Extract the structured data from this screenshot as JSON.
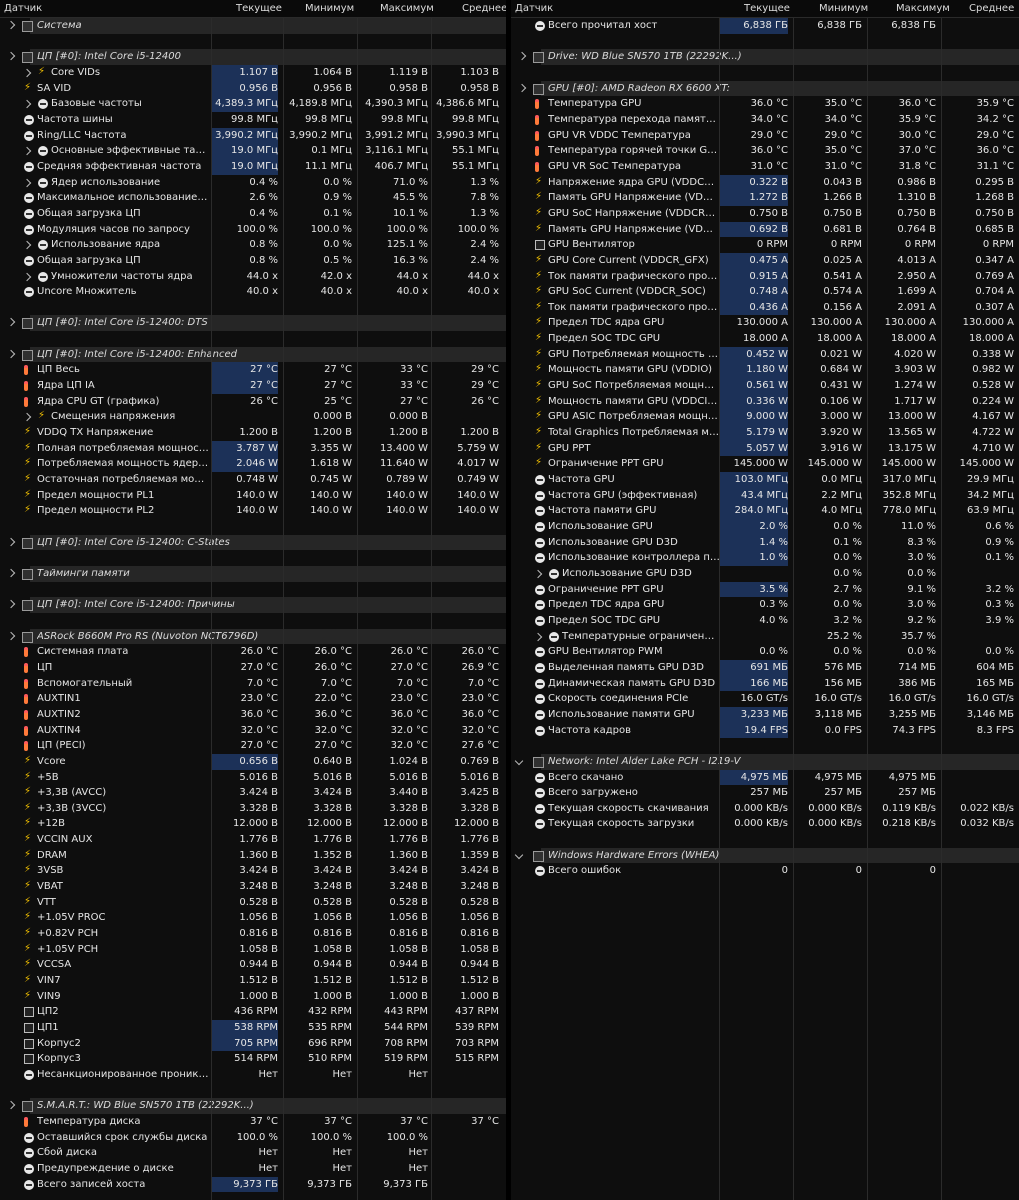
{
  "headers": {
    "sensor": "Датчик",
    "current": "Текущее",
    "min": "Минимум",
    "max": "Максимум",
    "avg": "Среднее"
  },
  "left": [
    {
      "t": "g",
      "name": "Система"
    },
    {
      "t": "s"
    },
    {
      "t": "g",
      "name": "ЦП [#0]: Intel Core i5-12400"
    },
    {
      "i": "bolt",
      "exp": 1,
      "ind": 1,
      "name": "Core VIDs",
      "c": "1.107 В",
      "mn": "1.064 В",
      "mx": "1.119 В",
      "av": "1.103 В",
      "h": 1
    },
    {
      "i": "bolt",
      "name": "SA VID",
      "c": "0.956 В",
      "mn": "0.956 В",
      "mx": "0.958 В",
      "av": "0.958 В",
      "h": 1
    },
    {
      "i": "clock",
      "exp": 1,
      "ind": 1,
      "name": "Базовые частоты",
      "c": "4,389.3 МГц",
      "mn": "4,189.8 МГц",
      "mx": "4,390.3 МГц",
      "av": "4,386.6 МГц",
      "h": 1
    },
    {
      "i": "clock",
      "name": "Частота шины",
      "c": "99.8 МГц",
      "mn": "99.8 МГц",
      "mx": "99.8 МГц",
      "av": "99.8 МГц"
    },
    {
      "i": "clock",
      "name": "Ring/LLC Частота",
      "c": "3,990.2 МГц",
      "mn": "3,990.2 МГц",
      "mx": "3,991.2 МГц",
      "av": "3,990.3 МГц",
      "h": 1
    },
    {
      "i": "clock",
      "exp": 1,
      "ind": 1,
      "name": "Основные эффективные тактовые частоты",
      "c": "19.0 МГц",
      "mn": "0.1 МГц",
      "mx": "3,116.1 МГц",
      "av": "55.1 МГц",
      "h": 1
    },
    {
      "i": "clock",
      "name": "Средняя эффективная частота",
      "c": "19.0 МГц",
      "mn": "11.1 МГц",
      "mx": "406.7 МГц",
      "av": "55.1 МГц",
      "h": 1
    },
    {
      "i": "clock",
      "exp": 1,
      "ind": 1,
      "name": "Ядер использование",
      "c": "0.4 %",
      "mn": "0.0 %",
      "mx": "71.0 %",
      "av": "1.3 %"
    },
    {
      "i": "clock",
      "name": "Максимальное использование ЦП / поток",
      "c": "2.6 %",
      "mn": "0.9 %",
      "mx": "45.5 %",
      "av": "7.8 %"
    },
    {
      "i": "clock",
      "name": "Общая загрузка ЦП",
      "c": "0.4 %",
      "mn": "0.1 %",
      "mx": "10.1 %",
      "av": "1.3 %"
    },
    {
      "i": "clock",
      "name": "Модуляция часов по запросу",
      "c": "100.0 %",
      "mn": "100.0 %",
      "mx": "100.0 %",
      "av": "100.0 %"
    },
    {
      "i": "clock",
      "exp": 1,
      "ind": 1,
      "name": "Использование ядра",
      "c": "0.8 %",
      "mn": "0.0 %",
      "mx": "125.1 %",
      "av": "2.4 %"
    },
    {
      "i": "clock",
      "name": "Общая загрузка ЦП",
      "c": "0.8 %",
      "mn": "0.5 %",
      "mx": "16.3 %",
      "av": "2.4 %"
    },
    {
      "i": "clock",
      "exp": 1,
      "ind": 1,
      "name": "Умножители частоты ядра",
      "c": "44.0 x",
      "mn": "42.0 x",
      "mx": "44.0 x",
      "av": "44.0 x"
    },
    {
      "i": "clock",
      "name": "Uncore Множитель",
      "c": "40.0 x",
      "mn": "40.0 x",
      "mx": "40.0 x",
      "av": "40.0 x"
    },
    {
      "t": "s"
    },
    {
      "t": "g",
      "name": "ЦП [#0]: Intel Core i5-12400: DTS"
    },
    {
      "t": "s"
    },
    {
      "t": "g",
      "name": "ЦП [#0]: Intel Core i5-12400: Enhanced"
    },
    {
      "i": "therm",
      "name": "ЦП Весь",
      "c": "27 °C",
      "mn": "27 °C",
      "mx": "33 °C",
      "av": "29 °C",
      "h": 1
    },
    {
      "i": "therm",
      "name": "Ядра ЦП IA",
      "c": "27 °C",
      "mn": "27 °C",
      "mx": "33 °C",
      "av": "29 °C",
      "h": 1
    },
    {
      "i": "therm",
      "name": "Ядра CPU GT (графика)",
      "c": "26 °C",
      "mn": "25 °C",
      "mx": "27 °C",
      "av": "26 °C"
    },
    {
      "i": "bolt",
      "exp": 1,
      "ind": 1,
      "name": "Смещения напряжения",
      "c": "",
      "mn": "0.000 В",
      "mx": "0.000 В",
      "av": ""
    },
    {
      "i": "bolt",
      "name": "VDDQ TX Напряжение",
      "c": "1.200 В",
      "mn": "1.200 В",
      "mx": "1.200 В",
      "av": "1.200 В"
    },
    {
      "i": "bolt",
      "name": "Полная потребляемая мощность ЦП",
      "c": "3.787 W",
      "mn": "3.355 W",
      "mx": "13.400 W",
      "av": "5.759 W",
      "h": 1
    },
    {
      "i": "bolt",
      "name": "Потребляемая мощность ядер IA",
      "c": "2.046 W",
      "mn": "1.618 W",
      "mx": "11.640 W",
      "av": "4.017 W",
      "h": 1
    },
    {
      "i": "bolt",
      "name": "Остаточная потребляемая мощность",
      "c": "0.748 W",
      "mn": "0.745 W",
      "mx": "0.789 W",
      "av": "0.749 W"
    },
    {
      "i": "bolt",
      "name": "Предел мощности PL1",
      "c": "140.0 W",
      "mn": "140.0 W",
      "mx": "140.0 W",
      "av": "140.0 W"
    },
    {
      "i": "bolt",
      "name": "Предел мощности PL2",
      "c": "140.0 W",
      "mn": "140.0 W",
      "mx": "140.0 W",
      "av": "140.0 W"
    },
    {
      "t": "s"
    },
    {
      "t": "g",
      "name": "ЦП [#0]: Intel Core i5-12400: C-States"
    },
    {
      "t": "s"
    },
    {
      "t": "g",
      "name": "Тайминги памяти"
    },
    {
      "t": "s"
    },
    {
      "t": "g",
      "name": "ЦП [#0]: Intel Core i5-12400: Причины"
    },
    {
      "t": "s"
    },
    {
      "t": "g",
      "name": "ASRock B660M Pro RS (Nuvoton NCT6796D)"
    },
    {
      "i": "therm",
      "name": "Системная плата",
      "c": "26.0 °C",
      "mn": "26.0 °C",
      "mx": "26.0 °C",
      "av": "26.0 °C"
    },
    {
      "i": "therm",
      "name": "ЦП",
      "c": "27.0 °C",
      "mn": "26.0 °C",
      "mx": "27.0 °C",
      "av": "26.9 °C"
    },
    {
      "i": "therm",
      "name": "Вспомогательный",
      "c": "7.0 °C",
      "mn": "7.0 °C",
      "mx": "7.0 °C",
      "av": "7.0 °C"
    },
    {
      "i": "therm",
      "name": "AUXTIN1",
      "c": "23.0 °C",
      "mn": "22.0 °C",
      "mx": "23.0 °C",
      "av": "23.0 °C"
    },
    {
      "i": "therm",
      "name": "AUXTIN2",
      "c": "36.0 °C",
      "mn": "36.0 °C",
      "mx": "36.0 °C",
      "av": "36.0 °C"
    },
    {
      "i": "therm",
      "name": "AUXTIN4",
      "c": "32.0 °C",
      "mn": "32.0 °C",
      "mx": "32.0 °C",
      "av": "32.0 °C"
    },
    {
      "i": "therm",
      "name": "ЦП (PECI)",
      "c": "27.0 °C",
      "mn": "27.0 °C",
      "mx": "32.0 °C",
      "av": "27.6 °C"
    },
    {
      "i": "bolt",
      "name": "Vcore",
      "c": "0.656 В",
      "mn": "0.640 В",
      "mx": "1.024 В",
      "av": "0.769 В",
      "h": 1
    },
    {
      "i": "bolt",
      "name": "+5В",
      "c": "5.016 В",
      "mn": "5.016 В",
      "mx": "5.016 В",
      "av": "5.016 В"
    },
    {
      "i": "bolt",
      "name": "+3,3В (AVCC)",
      "c": "3.424 В",
      "mn": "3.424 В",
      "mx": "3.440 В",
      "av": "3.425 В"
    },
    {
      "i": "bolt",
      "name": "+3,3В (3VCC)",
      "c": "3.328 В",
      "mn": "3.328 В",
      "mx": "3.328 В",
      "av": "3.328 В"
    },
    {
      "i": "bolt",
      "name": "+12В",
      "c": "12.000 В",
      "mn": "12.000 В",
      "mx": "12.000 В",
      "av": "12.000 В"
    },
    {
      "i": "bolt",
      "name": "VCCIN AUX",
      "c": "1.776 В",
      "mn": "1.776 В",
      "mx": "1.776 В",
      "av": "1.776 В"
    },
    {
      "i": "bolt",
      "name": "DRAM",
      "c": "1.360 В",
      "mn": "1.352 В",
      "mx": "1.360 В",
      "av": "1.359 В"
    },
    {
      "i": "bolt",
      "name": "3VSB",
      "c": "3.424 В",
      "mn": "3.424 В",
      "mx": "3.424 В",
      "av": "3.424 В"
    },
    {
      "i": "bolt",
      "name": "VBAT",
      "c": "3.248 В",
      "mn": "3.248 В",
      "mx": "3.248 В",
      "av": "3.248 В"
    },
    {
      "i": "bolt",
      "name": "VTT",
      "c": "0.528 В",
      "mn": "0.528 В",
      "mx": "0.528 В",
      "av": "0.528 В"
    },
    {
      "i": "bolt",
      "name": "+1.05V PROC",
      "c": "1.056 В",
      "mn": "1.056 В",
      "mx": "1.056 В",
      "av": "1.056 В"
    },
    {
      "i": "bolt",
      "name": "+0.82V PCH",
      "c": "0.816 В",
      "mn": "0.816 В",
      "mx": "0.816 В",
      "av": "0.816 В"
    },
    {
      "i": "bolt",
      "name": "+1.05V PCH",
      "c": "1.058 В",
      "mn": "1.058 В",
      "mx": "1.058 В",
      "av": "1.058 В"
    },
    {
      "i": "bolt",
      "name": "VCCSA",
      "c": "0.944 В",
      "mn": "0.944 В",
      "mx": "0.944 В",
      "av": "0.944 В"
    },
    {
      "i": "bolt",
      "name": "VIN7",
      "c": "1.512 В",
      "mn": "1.512 В",
      "mx": "1.512 В",
      "av": "1.512 В"
    },
    {
      "i": "bolt",
      "name": "VIN9",
      "c": "1.000 В",
      "mn": "1.000 В",
      "mx": "1.000 В",
      "av": "1.000 В"
    },
    {
      "i": "fan",
      "name": "ЦП2",
      "c": "436 RPM",
      "mn": "432 RPM",
      "mx": "443 RPM",
      "av": "437 RPM"
    },
    {
      "i": "fan",
      "name": "ЦП1",
      "c": "538 RPM",
      "mn": "535 RPM",
      "mx": "544 RPM",
      "av": "539 RPM",
      "h": 1
    },
    {
      "i": "fan",
      "name": "Корпус2",
      "c": "705 RPM",
      "mn": "696 RPM",
      "mx": "708 RPM",
      "av": "703 RPM",
      "h": 1
    },
    {
      "i": "fan",
      "name": "Корпус3",
      "c": "514 RPM",
      "mn": "510 RPM",
      "mx": "519 RPM",
      "av": "515 RPM"
    },
    {
      "i": "clock",
      "name": "Несанкционированное проникновение",
      "c": "Нет",
      "mn": "Нет",
      "mx": "Нет",
      "av": ""
    },
    {
      "t": "s"
    },
    {
      "t": "g",
      "name": "S.M.A.R.T.: WD Blue SN570 1TB (22292K...)"
    },
    {
      "i": "therm",
      "name": "Температура диска",
      "c": "37 °C",
      "mn": "37 °C",
      "mx": "37 °C",
      "av": "37 °C"
    },
    {
      "i": "clock",
      "name": "Оставшийся срок службы диска",
      "c": "100.0 %",
      "mn": "100.0 %",
      "mx": "100.0 %",
      "av": ""
    },
    {
      "i": "clock",
      "name": "Сбой диска",
      "c": "Нет",
      "mn": "Нет",
      "mx": "Нет",
      "av": ""
    },
    {
      "i": "clock",
      "name": "Предупреждение о диске",
      "c": "Нет",
      "mn": "Нет",
      "mx": "Нет",
      "av": ""
    },
    {
      "i": "clock",
      "name": "Всего записей хоста",
      "c": "9,373 ГБ",
      "mn": "9,373 ГБ",
      "mx": "9,373 ГБ",
      "av": "",
      "h": 1
    }
  ],
  "right": [
    {
      "i": "clock",
      "name": "Всего прочитал хост",
      "c": "6,838 ГБ",
      "mn": "6,838 ГБ",
      "mx": "6,838 ГБ",
      "av": "",
      "h": 1
    },
    {
      "t": "s"
    },
    {
      "t": "g",
      "name": "Drive: WD Blue SN570 1TB (22292K...)"
    },
    {
      "t": "s"
    },
    {
      "t": "g",
      "name": "GPU [#0]: AMD Radeon RX 6600 XT:"
    },
    {
      "i": "therm",
      "name": "Температура GPU",
      "c": "36.0 °C",
      "mn": "35.0 °C",
      "mx": "36.0 °C",
      "av": "35.9 °C"
    },
    {
      "i": "therm",
      "name": "Температура перехода памяти GPU",
      "c": "34.0 °C",
      "mn": "34.0 °C",
      "mx": "35.9 °C",
      "av": "34.2 °C"
    },
    {
      "i": "therm",
      "name": "GPU VR VDDC Температура",
      "c": "29.0 °C",
      "mn": "29.0 °C",
      "mx": "30.0 °C",
      "av": "29.0 °C"
    },
    {
      "i": "therm",
      "name": "Температура горячей точки GPU",
      "c": "36.0 °C",
      "mn": "35.0 °C",
      "mx": "37.0 °C",
      "av": "36.0 °C"
    },
    {
      "i": "therm",
      "name": "GPU VR SoC Температура",
      "c": "31.0 °C",
      "mn": "31.0 °C",
      "mx": "31.8 °C",
      "av": "31.1 °C"
    },
    {
      "i": "bolt",
      "name": "Напряжение ядра GPU (VDDCR_GFX)",
      "c": "0.322 В",
      "mn": "0.043 В",
      "mx": "0.986 В",
      "av": "0.295 В",
      "h": 1
    },
    {
      "i": "bolt",
      "name": "Память GPU Напряжение (VDDIO)",
      "c": "1.272 В",
      "mn": "1.266 В",
      "mx": "1.310 В",
      "av": "1.268 В",
      "h": 1
    },
    {
      "i": "bolt",
      "name": "GPU SoC Напряжение (VDDCR_SOC)",
      "c": "0.750 В",
      "mn": "0.750 В",
      "mx": "0.750 В",
      "av": "0.750 В"
    },
    {
      "i": "bolt",
      "name": "Память GPU Напряжение (VDDCI_MEM)",
      "c": "0.692 В",
      "mn": "0.681 В",
      "mx": "0.764 В",
      "av": "0.685 В",
      "h": 1
    },
    {
      "i": "fan",
      "name": "GPU Вентилятор",
      "c": "0 RPM",
      "mn": "0 RPM",
      "mx": "0 RPM",
      "av": "0 RPM"
    },
    {
      "i": "bolt",
      "name": "GPU Core Current (VDDCR_GFX)",
      "c": "0.475 A",
      "mn": "0.025 A",
      "mx": "4.013 A",
      "av": "0.347 A",
      "h": 1
    },
    {
      "i": "bolt",
      "name": "Ток памяти графического процессора",
      "c": "0.915 A",
      "mn": "0.541 A",
      "mx": "2.950 A",
      "av": "0.769 A",
      "h": 1
    },
    {
      "i": "bolt",
      "name": "GPU SoC Current (VDDCR_SOC)",
      "c": "0.748 A",
      "mn": "0.574 A",
      "mx": "1.699 A",
      "av": "0.704 A",
      "h": 1
    },
    {
      "i": "bolt",
      "name": "Ток памяти графического процессора",
      "c": "0.436 A",
      "mn": "0.156 A",
      "mx": "2.091 A",
      "av": "0.307 A",
      "h": 1
    },
    {
      "i": "bolt",
      "name": "Предел TDC ядра GPU",
      "c": "130.000 A",
      "mn": "130.000 A",
      "mx": "130.000 A",
      "av": "130.000 A"
    },
    {
      "i": "bolt",
      "name": "Предел SOC TDC GPU",
      "c": "18.000 A",
      "mn": "18.000 A",
      "mx": "18.000 A",
      "av": "18.000 A"
    },
    {
      "i": "bolt",
      "name": "GPU Потребляемая мощность ядра",
      "c": "0.452 W",
      "mn": "0.021 W",
      "mx": "4.020 W",
      "av": "0.338 W",
      "h": 1
    },
    {
      "i": "bolt",
      "name": "Мощность памяти GPU (VDDIO)",
      "c": "1.180 W",
      "mn": "0.684 W",
      "mx": "3.903 W",
      "av": "0.982 W",
      "h": 1
    },
    {
      "i": "bolt",
      "name": "GPU SoC Потребляемая мощность",
      "c": "0.561 W",
      "mn": "0.431 W",
      "mx": "1.274 W",
      "av": "0.528 W",
      "h": 1
    },
    {
      "i": "bolt",
      "name": "Мощность памяти GPU (VDDCI_MEM)",
      "c": "0.336 W",
      "mn": "0.106 W",
      "mx": "1.717 W",
      "av": "0.224 W",
      "h": 1
    },
    {
      "i": "bolt",
      "name": "GPU ASIC Потребляемая мощность",
      "c": "9.000 W",
      "mn": "3.000 W",
      "mx": "13.000 W",
      "av": "4.167 W",
      "h": 1
    },
    {
      "i": "bolt",
      "name": "Total Graphics Потребляемая мощность",
      "c": "5.179 W",
      "mn": "3.920 W",
      "mx": "13.565 W",
      "av": "4.722 W",
      "h": 1
    },
    {
      "i": "bolt",
      "name": "GPU PPT",
      "c": "5.057 W",
      "mn": "3.916 W",
      "mx": "13.175 W",
      "av": "4.710 W",
      "h": 1
    },
    {
      "i": "bolt",
      "name": "Ограничение PPT GPU",
      "c": "145.000 W",
      "mn": "145.000 W",
      "mx": "145.000 W",
      "av": "145.000 W"
    },
    {
      "i": "clock",
      "name": "Частота GPU",
      "c": "103.0 МГц",
      "mn": "0.0 МГц",
      "mx": "317.0 МГц",
      "av": "29.9 МГц",
      "h": 1
    },
    {
      "i": "clock",
      "name": "Частота GPU (эффективная)",
      "c": "43.4 МГц",
      "mn": "2.2 МГц",
      "mx": "352.8 МГц",
      "av": "34.2 МГц",
      "h": 1
    },
    {
      "i": "clock",
      "name": "Частота памяти GPU",
      "c": "284.0 МГц",
      "mn": "4.0 МГц",
      "mx": "778.0 МГц",
      "av": "63.9 МГц",
      "h": 1
    },
    {
      "i": "clock",
      "name": "Использование GPU",
      "c": "2.0 %",
      "mn": "0.0 %",
      "mx": "11.0 %",
      "av": "0.6 %",
      "h": 1
    },
    {
      "i": "clock",
      "name": "Использование GPU D3D",
      "c": "1.4 %",
      "mn": "0.1 %",
      "mx": "8.3 %",
      "av": "0.9 %",
      "h": 1
    },
    {
      "i": "clock",
      "name": "Использование контроллера памяти GPU",
      "c": "1.0 %",
      "mn": "0.0 %",
      "mx": "3.0 %",
      "av": "0.1 %",
      "h": 1
    },
    {
      "i": "clock",
      "exp": 1,
      "ind": 1,
      "name": "Использование GPU D3D",
      "c": "",
      "mn": "0.0 %",
      "mx": "0.0 %",
      "av": ""
    },
    {
      "i": "clock",
      "name": "Ограничение PPT GPU",
      "c": "3.5 %",
      "mn": "2.7 %",
      "mx": "9.1 %",
      "av": "3.2 %",
      "h": 1
    },
    {
      "i": "clock",
      "name": "Предел TDC ядра GPU",
      "c": "0.3 %",
      "mn": "0.0 %",
      "mx": "3.0 %",
      "av": "0.3 %"
    },
    {
      "i": "clock",
      "name": "Предел SOC TDC GPU",
      "c": "4.0 %",
      "mn": "3.2 %",
      "mx": "9.2 %",
      "av": "3.9 %"
    },
    {
      "i": "clock",
      "exp": 1,
      "ind": 1,
      "name": "Температурные ограничения GPU",
      "c": "",
      "mn": "25.2 %",
      "mx": "35.7 %",
      "av": ""
    },
    {
      "i": "clock",
      "name": "GPU Вентилятор PWM",
      "c": "0.0 %",
      "mn": "0.0 %",
      "mx": "0.0 %",
      "av": "0.0 %"
    },
    {
      "i": "clock",
      "name": "Выделенная память GPU D3D",
      "c": "691 МБ",
      "mn": "576 МБ",
      "mx": "714 МБ",
      "av": "604 МБ",
      "h": 1
    },
    {
      "i": "clock",
      "name": "Динамическая память GPU D3D",
      "c": "166 МБ",
      "mn": "156 МБ",
      "mx": "386 МБ",
      "av": "165 МБ",
      "h": 1
    },
    {
      "i": "clock",
      "name": "Скорость соединения PCIe",
      "c": "16.0 GT/s",
      "mn": "16.0 GT/s",
      "mx": "16.0 GT/s",
      "av": "16.0 GT/s"
    },
    {
      "i": "clock",
      "name": "Использование памяти GPU",
      "c": "3,233 МБ",
      "mn": "3,118 МБ",
      "mx": "3,255 МБ",
      "av": "3,146 МБ",
      "h": 1
    },
    {
      "i": "clock",
      "name": "Частота кадров",
      "c": "19.4 FPS",
      "mn": "0.0 FPS",
      "mx": "74.3 FPS",
      "av": "8.3 FPS",
      "h": 1
    },
    {
      "t": "s"
    },
    {
      "t": "g",
      "exp": "down",
      "name": "Network: Intel Alder Lake PCH - I219-V"
    },
    {
      "i": "clock",
      "name": "Всего скачано",
      "c": "4,975 МБ",
      "mn": "4,975 МБ",
      "mx": "4,975 МБ",
      "av": "",
      "h": 1
    },
    {
      "i": "clock",
      "name": "Всего загружено",
      "c": "257 МБ",
      "mn": "257 МБ",
      "mx": "257 МБ",
      "av": ""
    },
    {
      "i": "clock",
      "name": "Текущая скорость скачивания",
      "c": "0.000 KB/s",
      "mn": "0.000 KB/s",
      "mx": "0.119 KB/s",
      "av": "0.022 KB/s"
    },
    {
      "i": "clock",
      "name": "Текущая скорость загрузки",
      "c": "0.000 KB/s",
      "mn": "0.000 KB/s",
      "mx": "0.218 KB/s",
      "av": "0.032 KB/s"
    },
    {
      "t": "s"
    },
    {
      "t": "g",
      "exp": "down",
      "name": "Windows Hardware Errors (WHEA)"
    },
    {
      "i": "clock",
      "name": "Всего ошибок",
      "c": "0",
      "mn": "0",
      "mx": "0",
      "av": ""
    }
  ]
}
